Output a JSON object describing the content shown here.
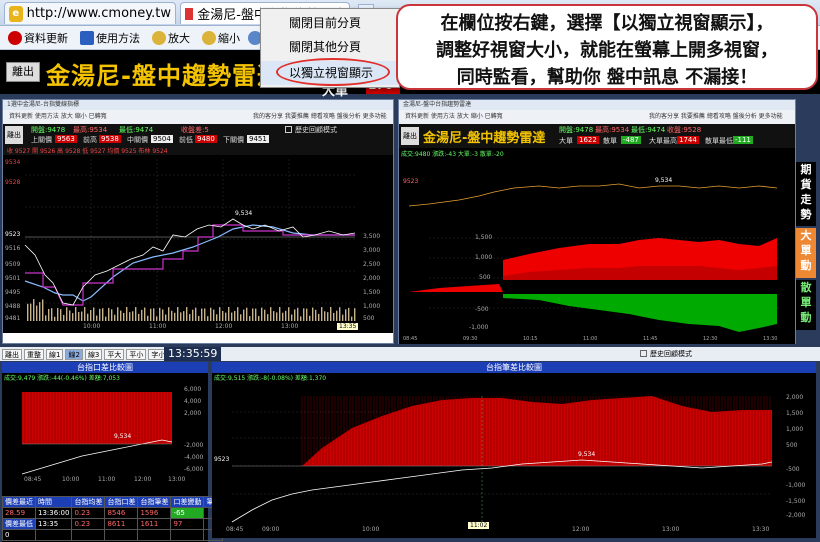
{
  "browser": {
    "tab1": {
      "title": "http://www.cmoney.tw"
    },
    "tab2": {
      "title": "金湯尼-盤中台指趨勢雷達"
    },
    "tab2_close": "x"
  },
  "toolbar": {
    "refresh": "資料更新",
    "howto": "使用方法",
    "zoom_in": "放大",
    "zoom_out": "縮小"
  },
  "context_menu": {
    "items": [
      "關閉目前分頁",
      "關閉其他分頁",
      "以獨立視窗顯示"
    ]
  },
  "callout": {
    "lines": [
      "在欄位按右鍵，選擇【以獨立視窗顯示】，",
      "調整好視窗大小，就能在螢幕上開多視窗，",
      "同時監看，幫助你 盤中訊息 不漏接！"
    ]
  },
  "app": {
    "exit": "離出",
    "title": "金湯尼-盤中趨勢雷達",
    "big_order_label": "大單",
    "big_order_value": "170"
  },
  "left_window": {
    "title": "1選中金湯尼-台指雙線指標",
    "tools": "資料更新  使用方法  放大  縮小  已轉寬",
    "tools_right": "我的客分享  我要推薦  總看攻略  盤後分析  更多功能",
    "exit": "離出",
    "open_label": "開盤:9478",
    "high_label": "最高:9534",
    "low_label": "最低:9474",
    "diff_label": "收盤差:5",
    "upper_label": "上關價",
    "upper_value": "9563",
    "prev_label": "前高",
    "prev_value": "9538",
    "mid_label": "中關價",
    "mid_value": "9504",
    "low2_label": "前低",
    "low2_value": "9480",
    "lower_label": "下關價",
    "lower_value": "9451",
    "history_toggle": "歷史回顧模式",
    "legend": "收 9527  開 9526  高 9528  低 9527  均價 9525  布林 9524",
    "y_ticks": [
      "9534",
      "9528",
      "9523",
      "9516",
      "9509",
      "9501",
      "9495",
      "9488",
      "9481",
      "9474"
    ],
    "y_right": [
      "3,500",
      "3,000",
      "2,500",
      "2,000",
      "1,500",
      "1,000",
      "500",
      "-500"
    ],
    "x_ticks": [
      "09:00",
      "10:00",
      "11:00",
      "12:00",
      "13:00"
    ],
    "peak_label": "9,534",
    "end_time": "13:35"
  },
  "right_window": {
    "title": "金湯尼-盤中台指趨勢雷達",
    "tools": "資料更新  使用方法  放大  縮小  已轉寬",
    "tools_right": "我的客分享  我要推薦  總看攻略  盤後分析  更多功能",
    "exit": "離出",
    "title_big": "金湯尼-盤中趨勢雷達",
    "open": "開盤:9478",
    "high": "最高:9534",
    "low": "最低:9474",
    "close": "收盤:9528",
    "big": "大單",
    "big_value": "1622",
    "small": "散單",
    "small_value": "-487",
    "big_max": "大單最高",
    "big_max_value": "1744",
    "small_max": "散單最低",
    "small_max_value": "-111",
    "stat_line": "成交:9480  漲跌:-43  大單:-3  散單:-20",
    "peak_label": "9,534",
    "y_big": [
      "1,500",
      "1,000",
      "500",
      "-500",
      "-1,000"
    ],
    "x_ticks": [
      "08:45",
      "09:00",
      "09:15",
      "09:30",
      "09:45",
      "10:00",
      "10:15",
      "10:30",
      "10:45",
      "11:00",
      "11:15",
      "11:30",
      "11:45",
      "12:00",
      "12:15",
      "12:30",
      "12:45",
      "13:00",
      "13:15",
      "13:30",
      "13:45"
    ],
    "side_buttons": [
      "期",
      "貨",
      "走",
      "勢",
      "大",
      "單",
      "動",
      "散",
      "單",
      "動"
    ]
  },
  "bottom": {
    "buttons": [
      "離出",
      "重整",
      "線1",
      "線2",
      "線3",
      "平大",
      "平小",
      "字小"
    ],
    "clock": "13:35:59",
    "history_toggle": "歷史回顧模式",
    "panel_left_title": "台指口差比較圖",
    "panel_left_stats": "成交:9,479  漲跌:-44(-0.46%)  差額:7,053",
    "panel_left_peak": "9,534",
    "panel_left_y": [
      "6,000",
      "4,000",
      "2,000",
      "-2,000",
      "-4,000",
      "-6,000"
    ],
    "panel_left_x": [
      "08:45",
      "10:00",
      "11:00",
      "12:00",
      "13:00"
    ],
    "panel_right_title": "台指筆差比較圖",
    "panel_right_stats": "成交:9,515  漲跌:-8(-0.08%)  差額:1,370",
    "panel_right_peak": "9,534",
    "panel_right_y": [
      "2,000",
      "1,500",
      "1,000",
      "500",
      "-500",
      "-1,000",
      "-1,500",
      "-2,000"
    ],
    "panel_right_x": [
      "08:45",
      "09:00",
      "10:00",
      "11:00",
      "11:02",
      "12:00",
      "13:00",
      "13:30"
    ],
    "table_headers": [
      "價差最近",
      "時間",
      "台指均差",
      "台指口差",
      "台指筆差",
      "口差變動",
      "筆差"
    ],
    "table_rows": [
      [
        "28.59",
        "13:36:00",
        "0.23",
        "8546",
        "1596",
        "-65",
        ""
      ],
      [
        "價差最低",
        "13:35",
        "0.23",
        "8611",
        "1611",
        "97",
        ""
      ],
      [
        "0",
        "",
        "",
        "",
        "",
        "",
        ""
      ]
    ]
  }
}
